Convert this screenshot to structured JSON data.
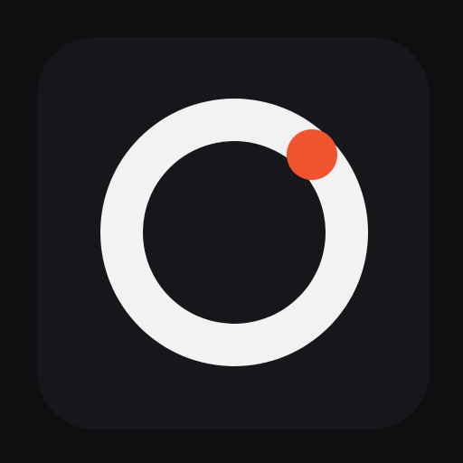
{
  "icon": {
    "name": "camera-ring-app-icon",
    "background_color": "#0e0f11",
    "tile_color": "#16171a",
    "ring_color": "#f2f2f3",
    "inner_color": "#16171a",
    "accent_dot_color": "#f0532d"
  }
}
